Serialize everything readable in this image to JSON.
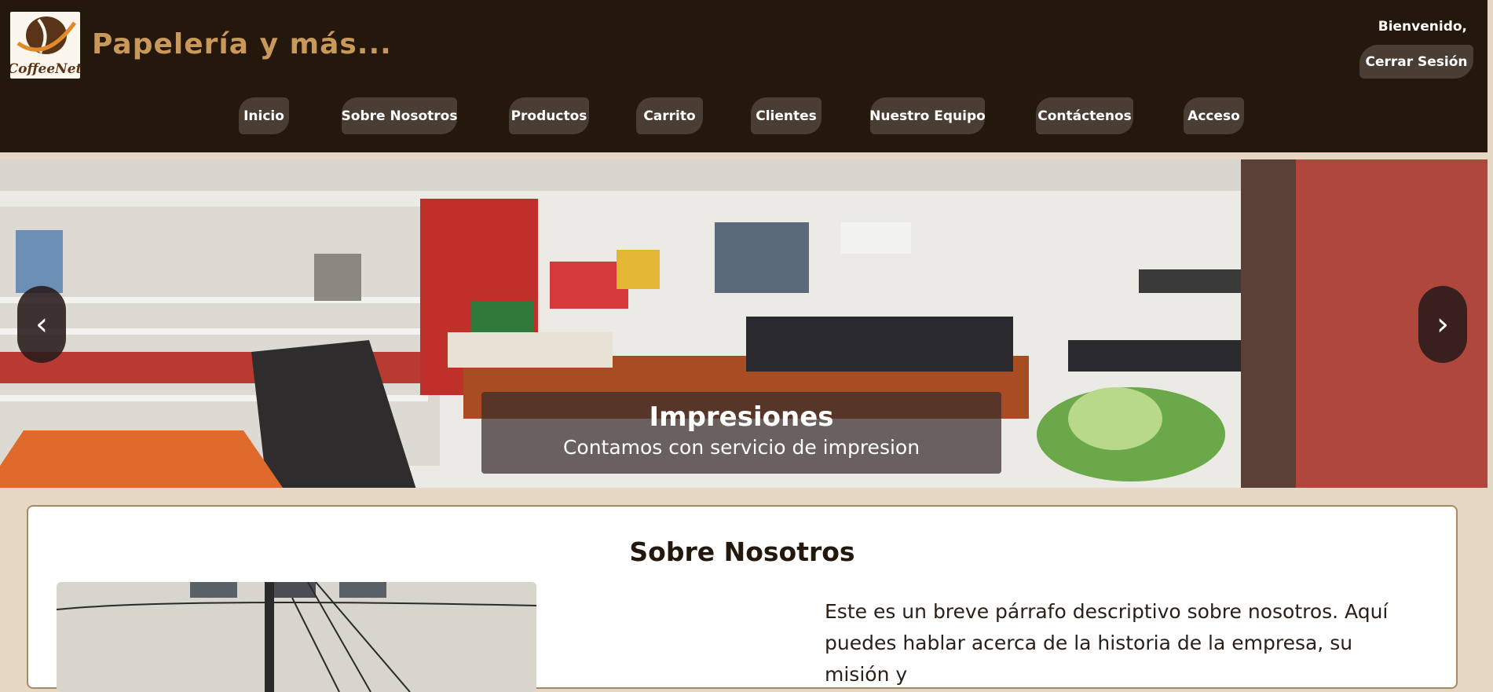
{
  "header": {
    "logo_text": "CoffeeNet",
    "site_title": "Papelería y más...",
    "welcome": "Bienvenido,",
    "logout_label": "Cerrar Sesión"
  },
  "nav": {
    "items": [
      {
        "label": "Inicio"
      },
      {
        "label": "Sobre Nosotros"
      },
      {
        "label": "Productos"
      },
      {
        "label": "Carrito"
      },
      {
        "label": "Clientes"
      },
      {
        "label": "Nuestro Equipo"
      },
      {
        "label": "Contáctenos"
      },
      {
        "label": "Acceso"
      }
    ]
  },
  "slider": {
    "prev_icon": "‹",
    "next_icon": "›",
    "caption_title": "Impresiones",
    "caption_text": "Contamos con servicio de impresion"
  },
  "about": {
    "title": "Sobre Nosotros",
    "paragraph": "Este es un breve párrafo descriptivo sobre nosotros. Aquí puedes hablar acerca de la historia de la empresa, su misión y"
  },
  "colors": {
    "header_bg": "#24170c",
    "nav_button": "#4a3d33",
    "title_gold": "#c8995a",
    "page_bg": "#e7d8c5"
  }
}
